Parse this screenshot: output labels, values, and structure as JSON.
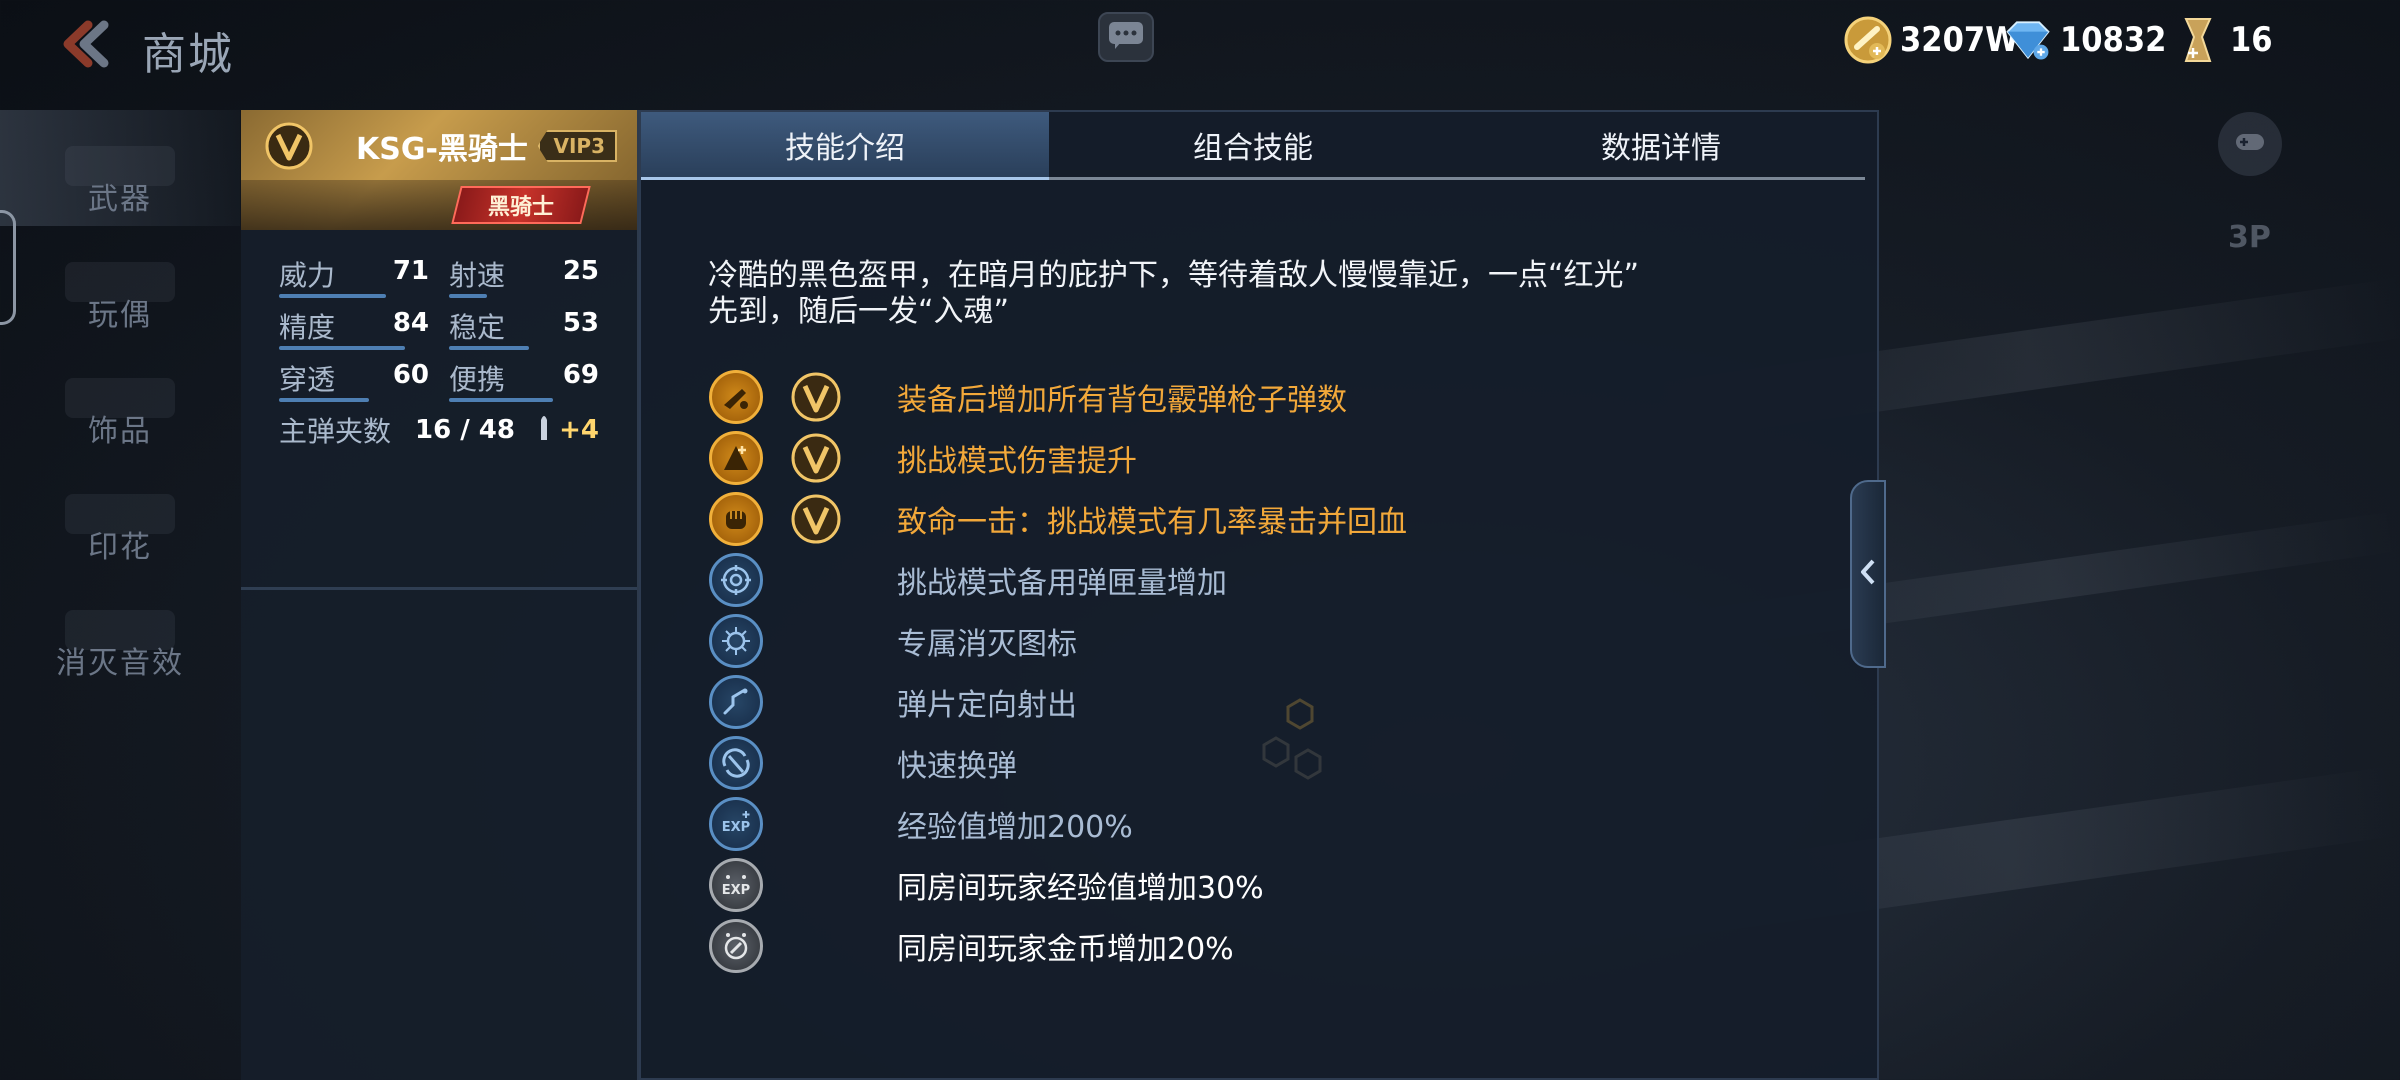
{
  "header": {
    "title": "商城",
    "currencies": [
      {
        "icon": "gold-coin-icon",
        "value": "3207W"
      },
      {
        "icon": "diamond-icon",
        "value": "10832"
      },
      {
        "icon": "medal-icon",
        "value": "16"
      }
    ]
  },
  "sidebar": {
    "items": [
      {
        "label": "武器",
        "active": true
      },
      {
        "label": "玩偶",
        "active": false
      },
      {
        "label": "饰品",
        "active": false
      },
      {
        "label": "印花",
        "active": false
      },
      {
        "label": "消灭音效",
        "active": false
      }
    ]
  },
  "weapon": {
    "name": "KSG-黑骑士",
    "vip": "VIP3",
    "skin_badge": "黑骑士",
    "stats": [
      {
        "label": "威力",
        "value": "71",
        "level": 0.71
      },
      {
        "label": "射速",
        "value": "25",
        "level": 0.25
      },
      {
        "label": "精度",
        "value": "84",
        "level": 0.84
      },
      {
        "label": "稳定",
        "value": "53",
        "level": 0.53
      },
      {
        "label": "穿透",
        "value": "60",
        "level": 0.6
      },
      {
        "label": "便携",
        "value": "69",
        "level": 0.69
      }
    ],
    "ammo_label": "主弹夹数",
    "ammo_value": "16 / 48",
    "ammo_extra": "+4"
  },
  "tabs": [
    {
      "label": "技能介绍",
      "active": true
    },
    {
      "label": "组合技能",
      "active": false
    },
    {
      "label": "数据详情",
      "active": false
    }
  ],
  "description_line1": "冷酷的黑色盔甲，在暗月的庇护下，等待着敌人慢慢靠近，一点“红光”",
  "description_line2": "先到，随后一发“入魂”",
  "skills": [
    {
      "icon": "shotgun-ammo-icon",
      "style": "gold",
      "vip": true,
      "text": "装备后增加所有背包霰弹枪子弹数"
    },
    {
      "icon": "damage-up-icon",
      "style": "gold",
      "vip": true,
      "text": "挑战模式伤害提升"
    },
    {
      "icon": "fist-icon",
      "style": "gold",
      "vip": true,
      "text": "致命一击：挑战模式有几率暴击并回血"
    },
    {
      "icon": "ammo-crosshair-icon",
      "style": "blue",
      "vip": false,
      "text": "挑战模式备用弹匣量增加"
    },
    {
      "icon": "kill-icon",
      "style": "blue",
      "vip": false,
      "text": "专属消灭图标"
    },
    {
      "icon": "directional-shot-icon",
      "style": "blue",
      "vip": false,
      "text": "弹片定向射出"
    },
    {
      "icon": "quick-reload-icon",
      "style": "blue",
      "vip": false,
      "text": "快速换弹"
    },
    {
      "icon": "exp-icon",
      "style": "blue",
      "vip": false,
      "text": "经验值增加200%"
    },
    {
      "icon": "room-exp-icon",
      "style": "gray",
      "vip": false,
      "text": "同房间玩家经验值增加30%"
    },
    {
      "icon": "room-coin-icon",
      "style": "gray",
      "vip": false,
      "text": "同房间玩家金币增加20%"
    }
  ],
  "side": {
    "view_label": "3P"
  },
  "colors": {
    "gold_text": "#f2a83a",
    "blue_text": "#a9bcd4",
    "accent_tab": "#3e5a7d",
    "vip_gold": "#d9b364"
  }
}
